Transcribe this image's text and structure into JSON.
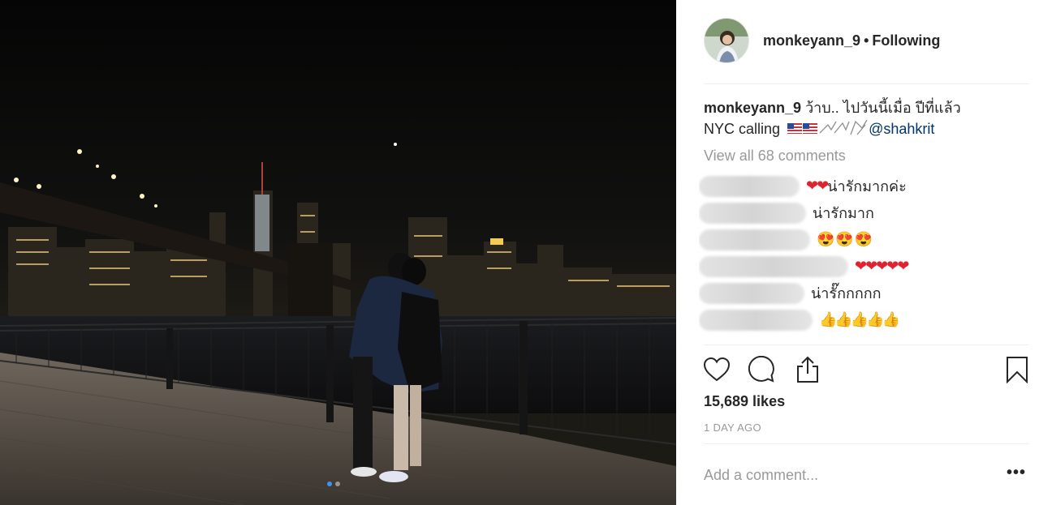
{
  "post": {
    "carousel": {
      "slide_count": 2,
      "active_slide": 1
    }
  },
  "header": {
    "username": "monkeyann_9",
    "separator": "•",
    "follow_status": "Following"
  },
  "caption": {
    "username": "monkeyann_9",
    "text_line1": "ว้าบ.. ไปวันนี้เมื่อ ปีที่แล้ว",
    "text_line2": "NYC calling",
    "mention": "@shahkrit"
  },
  "comments_link": "View all 68 comments",
  "comments": [
    {
      "emoji": "❤❤",
      "text": "น่ารักมากค่ะ"
    },
    {
      "emoji": "",
      "text": "น่ารักมาก"
    },
    {
      "emoji": "😍😍😍",
      "text": ""
    },
    {
      "emoji": "❤❤❤❤❤",
      "text": ""
    },
    {
      "emoji": "",
      "text": "น่ารั๊กกกกก"
    },
    {
      "emoji": "👍👍👍👍👍",
      "text": ""
    }
  ],
  "actions": {
    "like_icon": "heart-outline-icon",
    "comment_icon": "speech-bubble-icon",
    "share_icon": "share-upload-icon",
    "save_icon": "bookmark-icon"
  },
  "likes": "15,689 likes",
  "timestamp": "1 DAY AGO",
  "add_comment": {
    "placeholder": "Add a comment..."
  },
  "more_options": "•••",
  "colors": {
    "link_blue": "#003569",
    "active_dot": "#3897f0",
    "muted_text": "#999999",
    "heart_red": "#e0242f"
  }
}
